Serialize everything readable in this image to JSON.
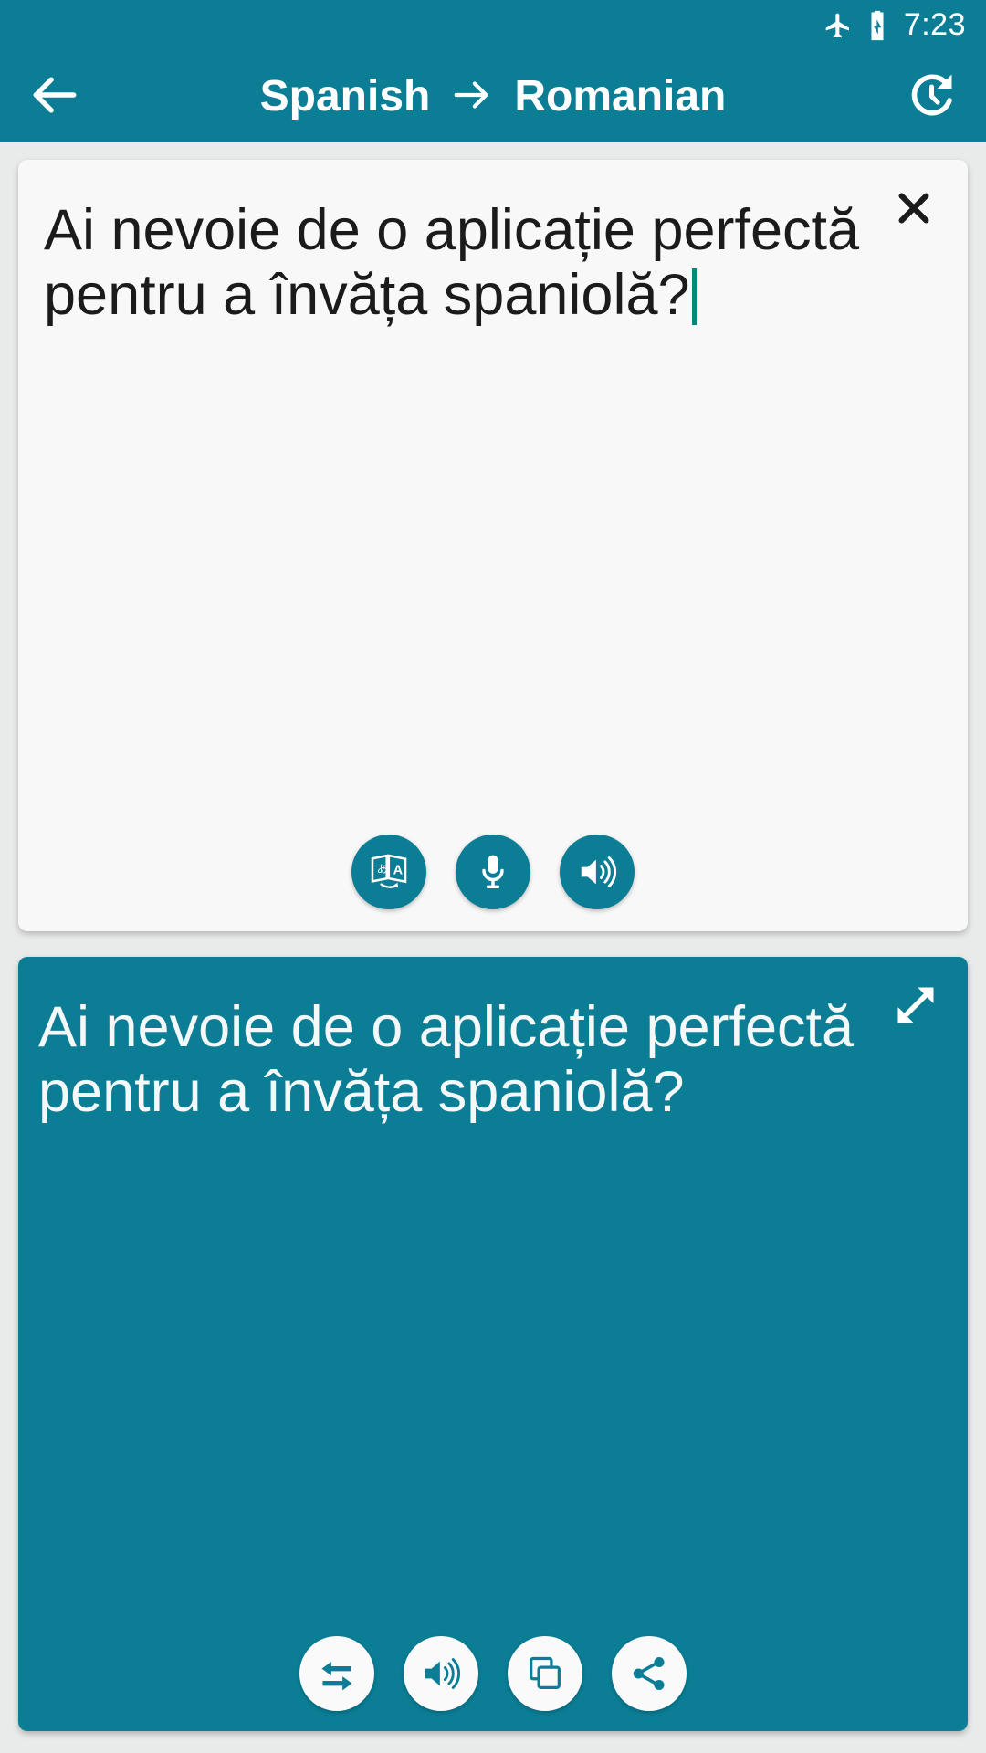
{
  "status_bar": {
    "time": "7:23",
    "icons": [
      "airplane-mode-icon",
      "battery-charging-icon"
    ]
  },
  "app_bar": {
    "back_icon": "back-arrow-icon",
    "source_language": "Spanish",
    "direction_arrow": "→",
    "target_language": "Romanian",
    "history_icon": "history-icon"
  },
  "source_card": {
    "close_icon": "close-icon",
    "text": "Ai nevoie de o aplicație perfectă pentru a învăța spaniolă?",
    "caret_visible": true,
    "actions": [
      {
        "name": "translate-button",
        "icon": "translate-icon"
      },
      {
        "name": "microphone-button",
        "icon": "microphone-icon"
      },
      {
        "name": "speak-source-button",
        "icon": "speaker-icon"
      }
    ]
  },
  "translation_card": {
    "expand_icon": "expand-icon",
    "text": "Ai nevoie de o aplicație perfectă pentru a învăța spaniolă?",
    "actions": [
      {
        "name": "swap-languages-button",
        "icon": "swap-arrows-icon"
      },
      {
        "name": "speak-translation-button",
        "icon": "speaker-icon"
      },
      {
        "name": "copy-button",
        "icon": "copy-icon"
      },
      {
        "name": "share-button",
        "icon": "share-icon"
      }
    ]
  },
  "colors": {
    "primary": "#0b7e96",
    "page_background": "#e9eaea",
    "source_card_background": "#f8f8f8",
    "caret": "#00897b",
    "source_text": "#1b1b1b",
    "translation_text": "#f4f8f8"
  }
}
